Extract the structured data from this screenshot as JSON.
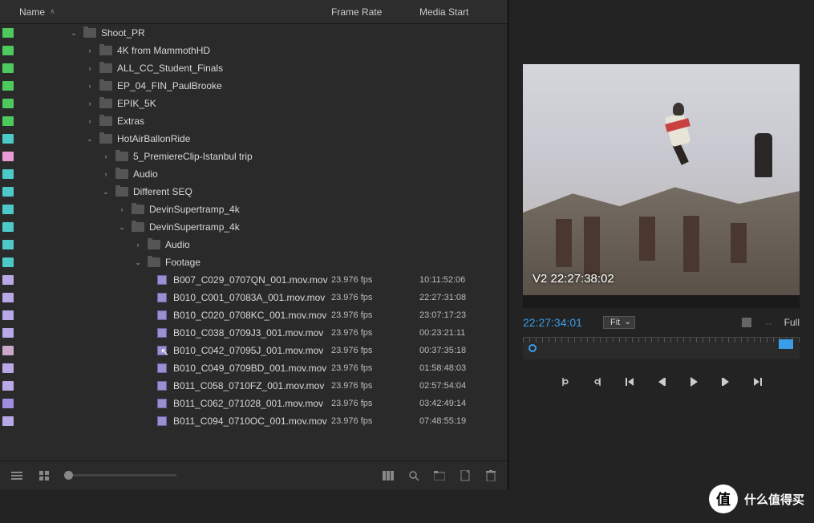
{
  "columns": {
    "name": "Name",
    "frameRate": "Frame Rate",
    "mediaStart": "Media Start"
  },
  "tree": [
    {
      "type": "folder",
      "label": "Shoot_PR",
      "indent": 86,
      "chip": "green",
      "arrow": "down"
    },
    {
      "type": "folder",
      "label": "4K from MammothHD",
      "indent": 106,
      "chip": "green",
      "arrow": "right"
    },
    {
      "type": "folder",
      "label": "ALL_CC_Student_Finals",
      "indent": 106,
      "chip": "green",
      "arrow": "right"
    },
    {
      "type": "folder",
      "label": "EP_04_FIN_PaulBrooke",
      "indent": 106,
      "chip": "green",
      "arrow": "right"
    },
    {
      "type": "folder",
      "label": "EPIK_5K",
      "indent": 106,
      "chip": "green",
      "arrow": "right"
    },
    {
      "type": "folder",
      "label": "Extras",
      "indent": 106,
      "chip": "green",
      "arrow": "right"
    },
    {
      "type": "folder",
      "label": "HotAirBallonRide",
      "indent": 106,
      "chip": "cyan",
      "arrow": "down"
    },
    {
      "type": "folder",
      "label": "5_PremiereClip-Istanbul trip",
      "indent": 126,
      "chip": "pink",
      "arrow": "right"
    },
    {
      "type": "folder",
      "label": "Audio",
      "indent": 126,
      "chip": "cyan",
      "arrow": "right"
    },
    {
      "type": "folder",
      "label": "Different SEQ",
      "indent": 126,
      "chip": "cyan",
      "arrow": "down"
    },
    {
      "type": "folder",
      "label": "DevinSupertramp_4k",
      "indent": 146,
      "chip": "cyan",
      "arrow": "right"
    },
    {
      "type": "folder",
      "label": "DevinSupertramp_4k",
      "indent": 146,
      "chip": "cyan",
      "arrow": "down"
    },
    {
      "type": "folder",
      "label": "Audio",
      "indent": 166,
      "chip": "cyan",
      "arrow": "right"
    },
    {
      "type": "folder",
      "label": "Footage",
      "indent": 166,
      "chip": "cyan",
      "arrow": "down"
    },
    {
      "type": "clip",
      "label": "B007_C029_0707QN_001.mov.mov",
      "indent": 196,
      "chip": "lav",
      "fr": "23.976 fps",
      "ms": "10:11:52:06"
    },
    {
      "type": "clip",
      "label": "B010_C001_07083A_001.mov.mov",
      "indent": 196,
      "chip": "lav",
      "fr": "23.976 fps",
      "ms": "22:27:31:08"
    },
    {
      "type": "clip",
      "label": "B010_C020_0708KC_001.mov.mov",
      "indent": 196,
      "chip": "lav",
      "fr": "23.976 fps",
      "ms": "23:07:17:23"
    },
    {
      "type": "clip",
      "label": "B010_C038_0709J3_001.mov.mov",
      "indent": 196,
      "chip": "lav",
      "fr": "23.976 fps",
      "ms": "00:23:21:11"
    },
    {
      "type": "clip",
      "label": "B010_C042_07095J_001.mov.mov",
      "indent": 196,
      "chip": "mauve",
      "fr": "23.976 fps",
      "ms": "00:37:35:18",
      "cursor": true
    },
    {
      "type": "clip",
      "label": "B010_C049_0709BD_001.mov.mov",
      "indent": 196,
      "chip": "lav",
      "fr": "23.976 fps",
      "ms": "01:58:48:03"
    },
    {
      "type": "clip",
      "label": "B011_C058_0710FZ_001.mov.mov",
      "indent": 196,
      "chip": "lav",
      "fr": "23.976 fps",
      "ms": "02:57:54:04"
    },
    {
      "type": "clip",
      "label": "B011_C062_071028_001.mov.mov",
      "indent": 196,
      "chip": "purple",
      "fr": "23.976 fps",
      "ms": "03:42:49:14"
    },
    {
      "type": "clip",
      "label": "B011_C094_0710OC_001.mov.mov",
      "indent": 196,
      "chip": "lav",
      "fr": "23.976 fps",
      "ms": "07:48:55:19"
    }
  ],
  "monitor": {
    "overlay": "V2 22:27:38:02",
    "timecode": "22:27:34:01",
    "zoom": "Fit",
    "resolution": "Full"
  },
  "watermark": "什么值得买"
}
